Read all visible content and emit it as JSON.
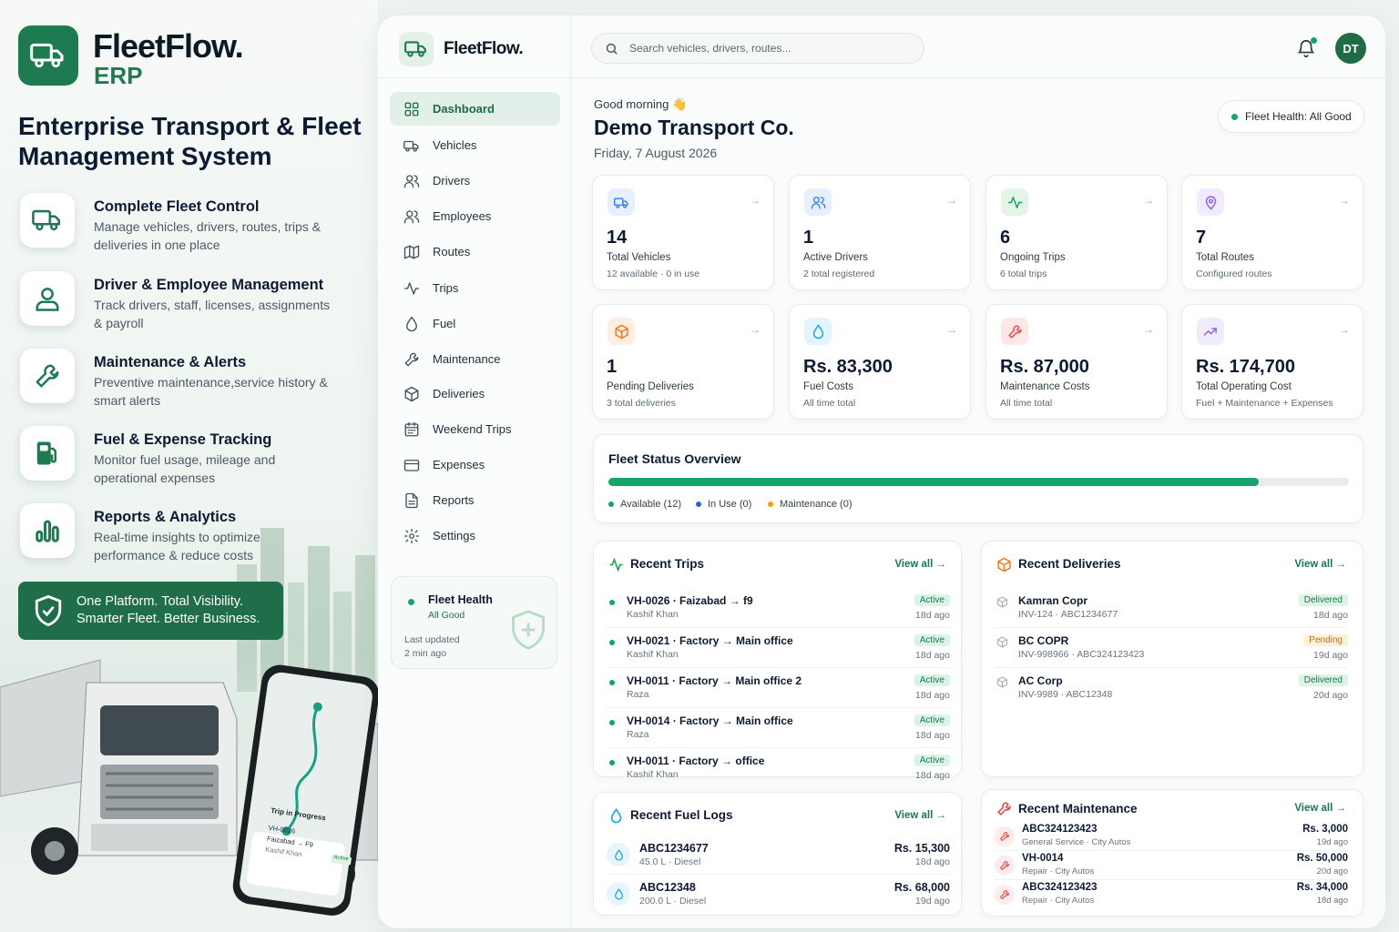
{
  "brand": {
    "name": "FleetFlow.",
    "sub": "ERP",
    "headline": "Enterprise Transport & Fleet Management System"
  },
  "features": [
    {
      "icon": "truck-icon",
      "title": "Complete Fleet Control",
      "desc": "Manage vehicles, drivers, routes, trips & deliveries in one place"
    },
    {
      "icon": "user-icon",
      "title": "Driver & Employee Management",
      "desc": "Track drivers, staff, licenses, assignments & payroll"
    },
    {
      "icon": "wrench-icon",
      "title": "Maintenance & Alerts",
      "desc": "Preventive maintenance,service history & smart alerts"
    },
    {
      "icon": "fuel-pump-icon",
      "title": "Fuel & Expense Tracking",
      "desc": "Monitor fuel usage, mileage and operational expenses"
    },
    {
      "icon": "bar-chart-icon",
      "title": "Reports & Analytics",
      "desc": "Real-time insights to optimize performance & reduce costs"
    }
  ],
  "banner": {
    "line1": "One Platform. Total Visibility.",
    "line2": "Smarter Fleet. Better Business."
  },
  "phone": {
    "title": "Trip in Progress",
    "trip": "VH-0026",
    "route": "Faizabad → F9",
    "driver": "Kashif Khan",
    "status": "Active"
  },
  "app": {
    "name": "FleetFlow.",
    "search_placeholder": "Search vehicles, drivers, routes...",
    "avatar": "DT",
    "nav": [
      {
        "label": "Dashboard",
        "icon": "grid-icon",
        "active": true
      },
      {
        "label": "Vehicles",
        "icon": "truck-icon"
      },
      {
        "label": "Drivers",
        "icon": "users-icon"
      },
      {
        "label": "Employees",
        "icon": "users-icon"
      },
      {
        "label": "Routes",
        "icon": "map-icon"
      },
      {
        "label": "Trips",
        "icon": "activity-icon"
      },
      {
        "label": "Fuel",
        "icon": "droplet-icon"
      },
      {
        "label": "Maintenance",
        "icon": "wrench-icon"
      },
      {
        "label": "Deliveries",
        "icon": "package-icon"
      },
      {
        "label": "Weekend Trips",
        "icon": "calendar-icon"
      },
      {
        "label": "Expenses",
        "icon": "wallet-icon"
      },
      {
        "label": "Reports",
        "icon": "file-icon"
      },
      {
        "label": "Settings",
        "icon": "gear-icon"
      }
    ],
    "health_card": {
      "title": "Fleet Health",
      "status": "All Good",
      "updated_label": "Last updated",
      "updated": "2 min ago"
    }
  },
  "greeting": {
    "hello": "Good morning 👋",
    "company": "Demo Transport Co.",
    "date": "Friday, 7 August 2026",
    "health_pill": "Fleet Health: All Good"
  },
  "stats": [
    {
      "value": "14",
      "label": "Total Vehicles",
      "sub": "12 available · 0 in use",
      "icon": "truck-icon",
      "color": "#3b82f6"
    },
    {
      "value": "1",
      "label": "Active Drivers",
      "sub": "2 total registered",
      "icon": "users-icon",
      "color": "#3b82f6"
    },
    {
      "value": "6",
      "label": "Ongoing Trips",
      "sub": "6 total trips",
      "icon": "activity-icon",
      "color": "#16a34a"
    },
    {
      "value": "7",
      "label": "Total Routes",
      "sub": "Configured routes",
      "icon": "map-pin-icon",
      "color": "#8b5cf6"
    },
    {
      "value": "1",
      "label": "Pending Deliveries",
      "sub": "3 total deliveries",
      "icon": "package-icon",
      "color": "#f97316"
    },
    {
      "value": "Rs. 83,300",
      "label": "Fuel Costs",
      "sub": "All time total",
      "icon": "droplet-icon",
      "color": "#0ea5e9"
    },
    {
      "value": "Rs. 87,000",
      "label": "Maintenance Costs",
      "sub": "All time total",
      "icon": "wrench-icon",
      "color": "#ef4444"
    },
    {
      "value": "Rs. 174,700",
      "label": "Total Operating Cost",
      "sub": "Fuel + Maintenance + Expenses",
      "icon": "trending-up-icon",
      "color": "#8b5cf6"
    }
  ],
  "fleet_status": {
    "title": "Fleet Status Overview",
    "available_fraction": 0.878,
    "legend": [
      {
        "label": "Available (12)",
        "color": "#13a56b"
      },
      {
        "label": "In Use (0)",
        "color": "#2563eb"
      },
      {
        "label": "Maintenance (0)",
        "color": "#f59e0b"
      }
    ]
  },
  "view_all": "View all",
  "recent_trips": {
    "title": "Recent Trips",
    "rows": [
      {
        "title": "VH-0026 · Faizabad → f9",
        "sub": "Kashif Khan",
        "badge": "Active",
        "ago": "18d ago"
      },
      {
        "title": "VH-0021 · Factory → Main office",
        "sub": "Kashif Khan",
        "badge": "Active",
        "ago": "18d ago"
      },
      {
        "title": "VH-0011 · Factory → Main office 2",
        "sub": "Raza",
        "badge": "Active",
        "ago": "18d ago"
      },
      {
        "title": "VH-0014 · Factory → Main office",
        "sub": "Raza",
        "badge": "Active",
        "ago": "18d ago"
      },
      {
        "title": "VH-0011 · Factory → office",
        "sub": "Kashif Khan",
        "badge": "Active",
        "ago": "18d ago"
      }
    ]
  },
  "recent_deliveries": {
    "title": "Recent Deliveries",
    "rows": [
      {
        "title": "Kamran Copr",
        "sub": "INV-124 · ABC1234677",
        "badge": "Delivered",
        "ago": "18d ago"
      },
      {
        "title": "BC COPR",
        "sub": "INV-998966 · ABC324123423",
        "badge": "Pending",
        "ago": "19d ago"
      },
      {
        "title": "AC Corp",
        "sub": "INV-9989 · ABC12348",
        "badge": "Delivered",
        "ago": "20d ago"
      }
    ]
  },
  "recent_fuel": {
    "title": "Recent Fuel Logs",
    "rows": [
      {
        "title": "ABC1234677",
        "sub": "45.0 L · Diesel",
        "amount": "Rs. 15,300",
        "ago": "18d ago"
      },
      {
        "title": "ABC12348",
        "sub": "200.0 L · Diesel",
        "amount": "Rs. 68,000",
        "ago": "19d ago"
      }
    ]
  },
  "recent_maintenance": {
    "title": "Recent Maintenance",
    "rows": [
      {
        "title": "ABC324123423",
        "sub": "General Service · City Autos",
        "amount": "Rs. 3,000",
        "ago": "19d ago"
      },
      {
        "title": "VH-0014",
        "sub": "Repair · City Autos",
        "amount": "Rs. 50,000",
        "ago": "20d ago"
      },
      {
        "title": "ABC324123423",
        "sub": "Repair · City Autos",
        "amount": "Rs. 34,000",
        "ago": "18d ago"
      }
    ]
  }
}
